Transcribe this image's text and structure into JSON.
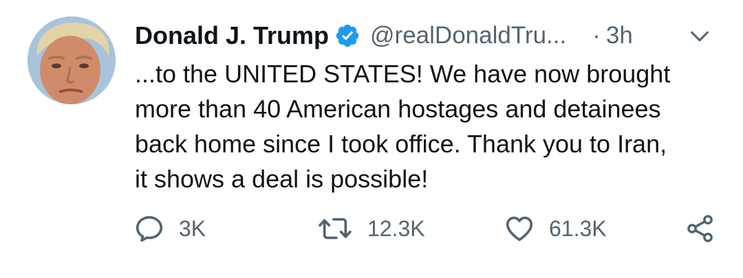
{
  "tweet": {
    "author": {
      "name": "Donald J. Trump",
      "handle": "@realDonaldTru...",
      "verified": true
    },
    "separator": "·",
    "time": "3h",
    "text_lines": [
      "...to the UNITED STATES! We have now brought",
      "more than 40 American hostages and detainees",
      "back home since I took office. Thank you to Iran,",
      "it shows a deal is possible!"
    ],
    "actions": {
      "reply_count": "3K",
      "retweet_count": "12.3K",
      "like_count": "61.3K"
    }
  },
  "icons": {
    "verified": "verified-badge-icon",
    "menu": "chevron-down-icon",
    "reply": "reply-icon",
    "retweet": "retweet-icon",
    "like": "heart-icon",
    "share": "share-icon"
  },
  "colors": {
    "verified_blue": "#1d9bf0",
    "secondary_text": "#536471",
    "primary_text": "#0f1419",
    "background": "#ffffff"
  }
}
